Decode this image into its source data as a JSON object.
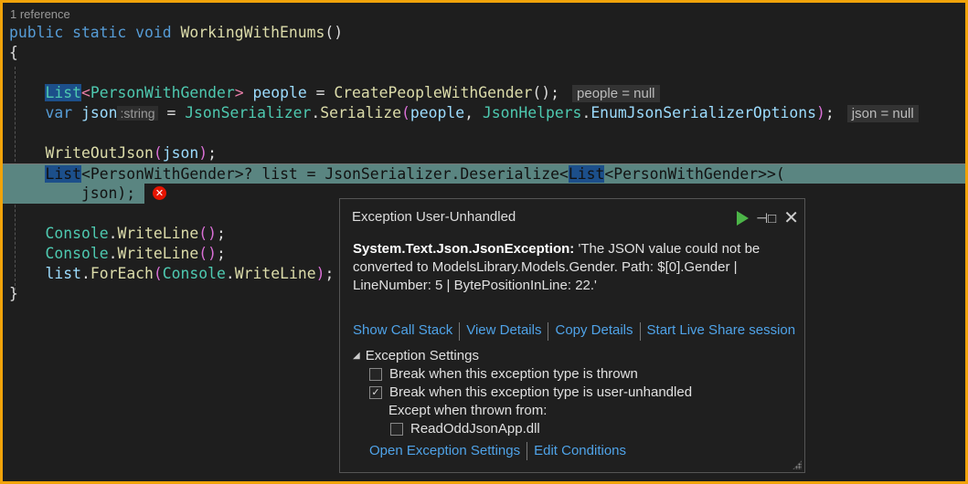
{
  "editor": {
    "reference_lens": "1 reference",
    "lines": [
      [
        [
          "public static void ",
          "kw"
        ],
        [
          "WorkingWithEnums",
          "fn"
        ],
        [
          "()",
          "pl"
        ]
      ],
      [
        [
          "{",
          "pl"
        ]
      ],
      [],
      [
        [
          "    ",
          "pl"
        ],
        [
          "List",
          "ty sel"
        ],
        [
          "<",
          "ang"
        ],
        [
          "PersonWithGender",
          "ty"
        ],
        [
          "> ",
          "ang"
        ],
        [
          "people",
          "va"
        ],
        [
          " = ",
          "pl"
        ],
        [
          "CreatePeopleWithGender",
          "fn"
        ],
        [
          "();",
          "pl"
        ],
        [
          "people = null",
          "hint"
        ]
      ],
      [
        [
          "    ",
          "pl"
        ],
        [
          "var ",
          "kw"
        ],
        [
          "json",
          "va"
        ],
        [
          ":string",
          "ihint"
        ],
        [
          " = ",
          "pl"
        ],
        [
          "JsonSerializer",
          "ty"
        ],
        [
          ".",
          "pl"
        ],
        [
          "Serialize",
          "fn"
        ],
        [
          "(",
          "pa"
        ],
        [
          "people",
          "va"
        ],
        [
          ", ",
          "pl"
        ],
        [
          "JsonHelpers",
          "ty"
        ],
        [
          ".",
          "pl"
        ],
        [
          "EnumJsonSerializerOptions",
          "va"
        ],
        [
          ")",
          "pa"
        ],
        [
          ";",
          "pl"
        ],
        [
          "json = null",
          "hint"
        ]
      ],
      [],
      [
        [
          "    ",
          "pl"
        ],
        [
          "WriteOutJson",
          "fn"
        ],
        [
          "(",
          "pa"
        ],
        [
          "json",
          "va"
        ],
        [
          ")",
          "pa"
        ],
        [
          ";",
          "pl"
        ]
      ],
      [
        [
          "    ",
          "pl"
        ],
        [
          "List",
          "ty sel"
        ],
        [
          "<PersonWithGender>? list = JsonSerializer.Deserialize<",
          "pl"
        ],
        [
          "List",
          "pl sel"
        ],
        [
          "<PersonWithGender>>(",
          "pl"
        ]
      ],
      [
        [
          "        json);",
          "pl"
        ]
      ],
      [],
      [
        [
          "    ",
          "pl"
        ],
        [
          "Console",
          "ty"
        ],
        [
          ".",
          "pl"
        ],
        [
          "WriteLine",
          "fn"
        ],
        [
          "()",
          "pa"
        ],
        [
          ";",
          "pl"
        ]
      ],
      [
        [
          "    ",
          "pl"
        ],
        [
          "Console",
          "ty"
        ],
        [
          ".",
          "pl"
        ],
        [
          "WriteLine",
          "fn"
        ],
        [
          "()",
          "pa"
        ],
        [
          ";",
          "pl"
        ]
      ],
      [
        [
          "    ",
          "pl"
        ],
        [
          "list",
          "va"
        ],
        [
          ".",
          "pl"
        ],
        [
          "ForEach",
          "fn"
        ],
        [
          "(",
          "pa"
        ],
        [
          "Console",
          "ty"
        ],
        [
          ".",
          "pl"
        ],
        [
          "WriteLine",
          "fn"
        ],
        [
          ")",
          "pa"
        ],
        [
          ";",
          "pl"
        ]
      ],
      [
        [
          "}",
          "pl"
        ]
      ]
    ]
  },
  "exception_popup": {
    "title": "Exception User-Unhandled",
    "exception_type": "System.Text.Json.JsonException:",
    "message": " 'The JSON value could not be converted to ModelsLibrary.Models.Gender. Path: $[0].Gender | LineNumber: 5 | BytePositionInLine: 22.'",
    "links": [
      "Show Call Stack",
      "View Details",
      "Copy Details",
      "Start Live Share session"
    ],
    "settings_header": "Exception Settings",
    "break_thrown": {
      "label": "Break when this exception type is thrown",
      "checked": false
    },
    "break_unhandled": {
      "label": "Break when this exception type is user-unhandled",
      "checked": true
    },
    "except_label": "Except when thrown from:",
    "except_module": {
      "label": "ReadOddJsonApp.dll",
      "checked": false
    },
    "footer_links": [
      "Open Exception Settings",
      "Edit Conditions"
    ]
  }
}
